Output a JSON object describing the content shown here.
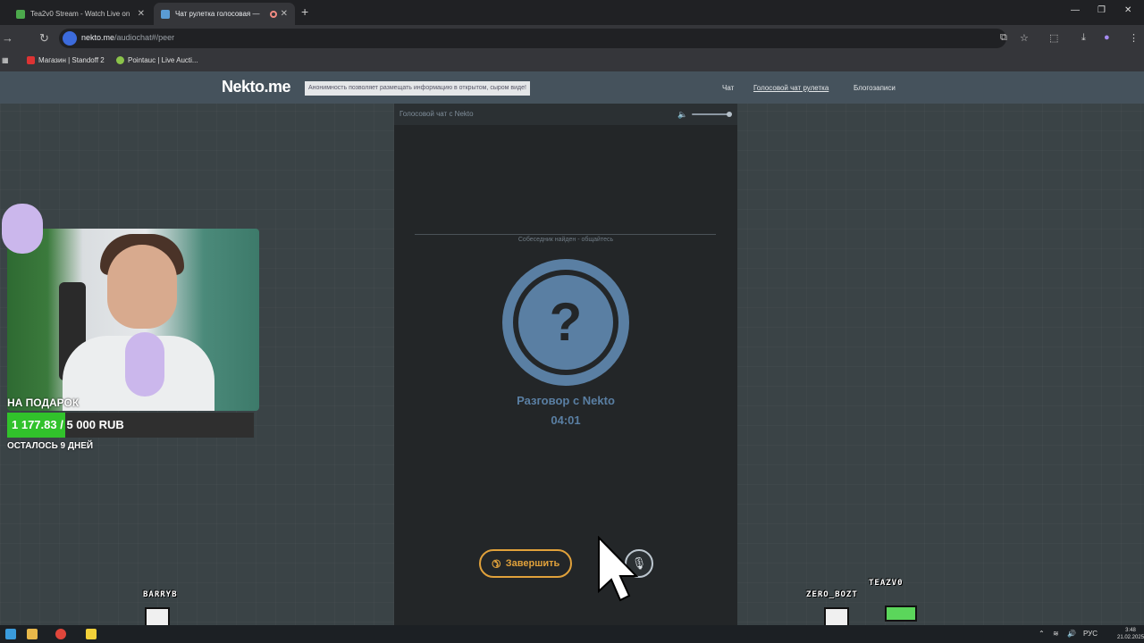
{
  "browser": {
    "tabs": [
      {
        "title": "Tea2v0 Stream - Watch Live on"
      },
      {
        "title": "Чат рулетка голосовая — "
      }
    ],
    "url_host": "nekto.me",
    "url_path": "/audiochat#/peer",
    "bookmarks": [
      "Магазин | Standoff 2",
      "Pointauc | Live Aucti..."
    ]
  },
  "site": {
    "logo": "Nekto.me",
    "notice": "Анонимность позволяет размещать информацию в открытом, сыром виде!",
    "nav": [
      "Чат",
      "Голосовой чат рулетка",
      "Блогозаписи"
    ]
  },
  "chat_panel": {
    "title": "Голосовой чат с Nekto",
    "status": "Собеседник найден - общайтесь",
    "avatar_symbol": "?",
    "conversation_title": "Разговор с Nekto",
    "timer": "04:01",
    "end_button": "Завершить",
    "volume_level": 0.9
  },
  "stream_overlay": {
    "gift_label": "НА ПОДАРОК",
    "gift_amount": "1 177.83 / 5 000 RUB",
    "gift_progress": 0.235,
    "days_left": "ОСТАЛОСЬ 9 ДНЕЙ",
    "chatters": [
      "BARRYB",
      "TEAZV0",
      "ZERO_BOZT"
    ]
  },
  "taskbar": {
    "language": "РУС",
    "time": "3:48",
    "date": "21.02.2025"
  },
  "colors": {
    "accent_blue": "#5a7fa3",
    "end_button": "#e0a13b",
    "header": "#45525c",
    "panel": "#232628",
    "progress_fill": "#31c22b"
  }
}
